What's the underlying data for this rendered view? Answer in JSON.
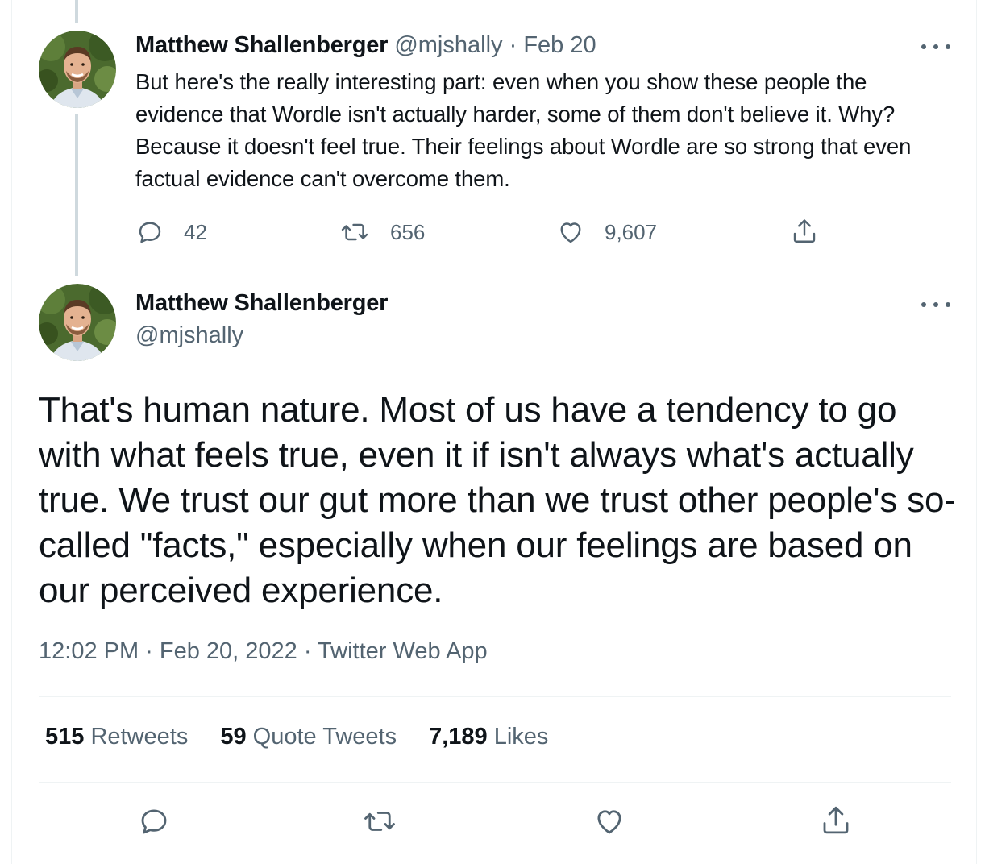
{
  "tweet1": {
    "name": "Matthew Shallenberger",
    "handle": "@mjshally",
    "separator": "·",
    "date": "Feb 20",
    "text": "But here's the really interesting part: even when you show these people the evidence that Wordle isn't actually harder, some of them don't believe it. Why? Because it doesn't feel true. Their feelings about Wordle are so strong that even factual evidence can't overcome them.",
    "replies": "42",
    "retweets": "656",
    "likes": "9,607"
  },
  "tweet2": {
    "name": "Matthew Shallenberger",
    "handle": "@mjshally",
    "text": "That's human nature. Most of us have a tendency to go with what feels true, even it if isn't always what's actually true. We trust our gut more than we trust other people's so-called \"facts,\" especially when our feelings are based on our perceived experience.",
    "meta": "12:02 PM · Feb 20, 2022 · Twitter Web App",
    "stats": {
      "retweets_count": "515",
      "retweets_label": "Retweets",
      "quotes_count": "59",
      "quotes_label": "Quote Tweets",
      "likes_count": "7,189",
      "likes_label": "Likes"
    }
  },
  "icons": {
    "reply": "reply-icon",
    "retweet": "retweet-icon",
    "like": "heart-icon",
    "share": "share-icon",
    "more": "more-icon"
  },
  "colors": {
    "text": "#0f1419",
    "muted": "#536471",
    "thread_line": "#cfd9de",
    "divider": "#eff3f4"
  }
}
